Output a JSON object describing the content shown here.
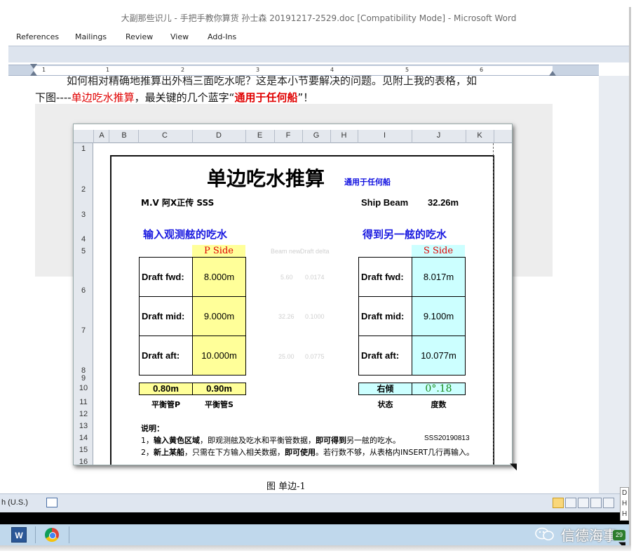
{
  "window": {
    "title": "大副那些识儿 - 手把手教你算货 孙士森 20191217-2529.doc [Compatibility Mode] - Microsoft Word"
  },
  "ribbon": {
    "tabs": [
      "References",
      "Mailings",
      "Review",
      "View",
      "Add-Ins"
    ]
  },
  "ruler": {
    "numbers": [
      "1",
      "1",
      "2",
      "3",
      "4",
      "5",
      "6"
    ]
  },
  "doc": {
    "line1": "如何相对精确地推算出外档三面吃水呢？这是本小节要解决的问题。见附上我的表格，如",
    "line2_prefix": "下图----",
    "line2_red": "单边吃水推算",
    "line2_middle": "，最关键的几个蓝字“",
    "line2_redbold": "通用于任何船",
    "line2_suffix": "”！",
    "caption": "图 单边-1"
  },
  "sheet": {
    "columns": [
      "A",
      "B",
      "C",
      "D",
      "E",
      "F",
      "G",
      "H",
      "I",
      "J",
      "K"
    ],
    "rows": [
      "1",
      "2",
      "3",
      "4",
      "5",
      "6",
      "7",
      "8",
      "9",
      "10",
      "11",
      "12",
      "13",
      "14",
      "15",
      "16"
    ],
    "title": "单边吃水推算",
    "subtitle": "通用于任何船",
    "ship_name": "M.V 阿X正传 SSS",
    "beam_label": "Ship Beam",
    "beam_value": "32.26m",
    "input_heading": "输入观测舷的吃水",
    "output_heading": "得到另一舷的吃水",
    "p_side_header": "P Side",
    "s_side_header": "S Side",
    "helper_headers": [
      "Beam new",
      "Draft delta"
    ],
    "helper_values": [
      [
        "5.60",
        "0.0174"
      ],
      [
        "32.26",
        "0.1000"
      ],
      [
        "25.00",
        "0.0775"
      ]
    ],
    "p_drafts": [
      {
        "label": "Draft fwd:",
        "value": "8.000m"
      },
      {
        "label": "Draft mid:",
        "value": "9.000m"
      },
      {
        "label": "Draft aft:",
        "value": "10.000m"
      }
    ],
    "s_drafts": [
      {
        "label": "Draft fwd:",
        "value": "8.017m"
      },
      {
        "label": "Draft mid:",
        "value": "9.100m"
      },
      {
        "label": "Draft aft:",
        "value": "10.077m"
      }
    ],
    "ballast_p_value": "0.80m",
    "ballast_s_value": "0.90m",
    "ballast_p_label": "平衡管P",
    "ballast_s_label": "平衡管S",
    "list_state": "右倾",
    "list_degree": "0°.18",
    "state_label": "状态",
    "degree_label": "度数",
    "note_title": "说明：",
    "note1_a": "1，",
    "note1_b": "输入黄色区域",
    "note1_c": "，即观测舷及吃水和平衡管数据，",
    "note1_d": "即可得到",
    "note1_e": "另一舷的吃水。",
    "note1_code": "SSS20190813",
    "note2_a": "2，",
    "note2_b": "新上某船",
    "note2_c": "，只需在下方输入相关数据，",
    "note2_d": "即可使用",
    "note2_e": "。若行数不够，从表格内INSERT几行再输入。"
  },
  "statusbar": {
    "language": "h (U.S.)"
  },
  "taskbar": {
    "word_label": "W",
    "watermark": "信德海事",
    "tray_badge": "29"
  },
  "side_panel": {
    "letters": [
      "D",
      "H",
      "H"
    ]
  },
  "colors": {
    "yellow": "#ffff99",
    "cyan": "#ccffff",
    "blue_text": "#1a1ae0",
    "red_text": "#e00000",
    "green_text": "#1a8a1a"
  }
}
